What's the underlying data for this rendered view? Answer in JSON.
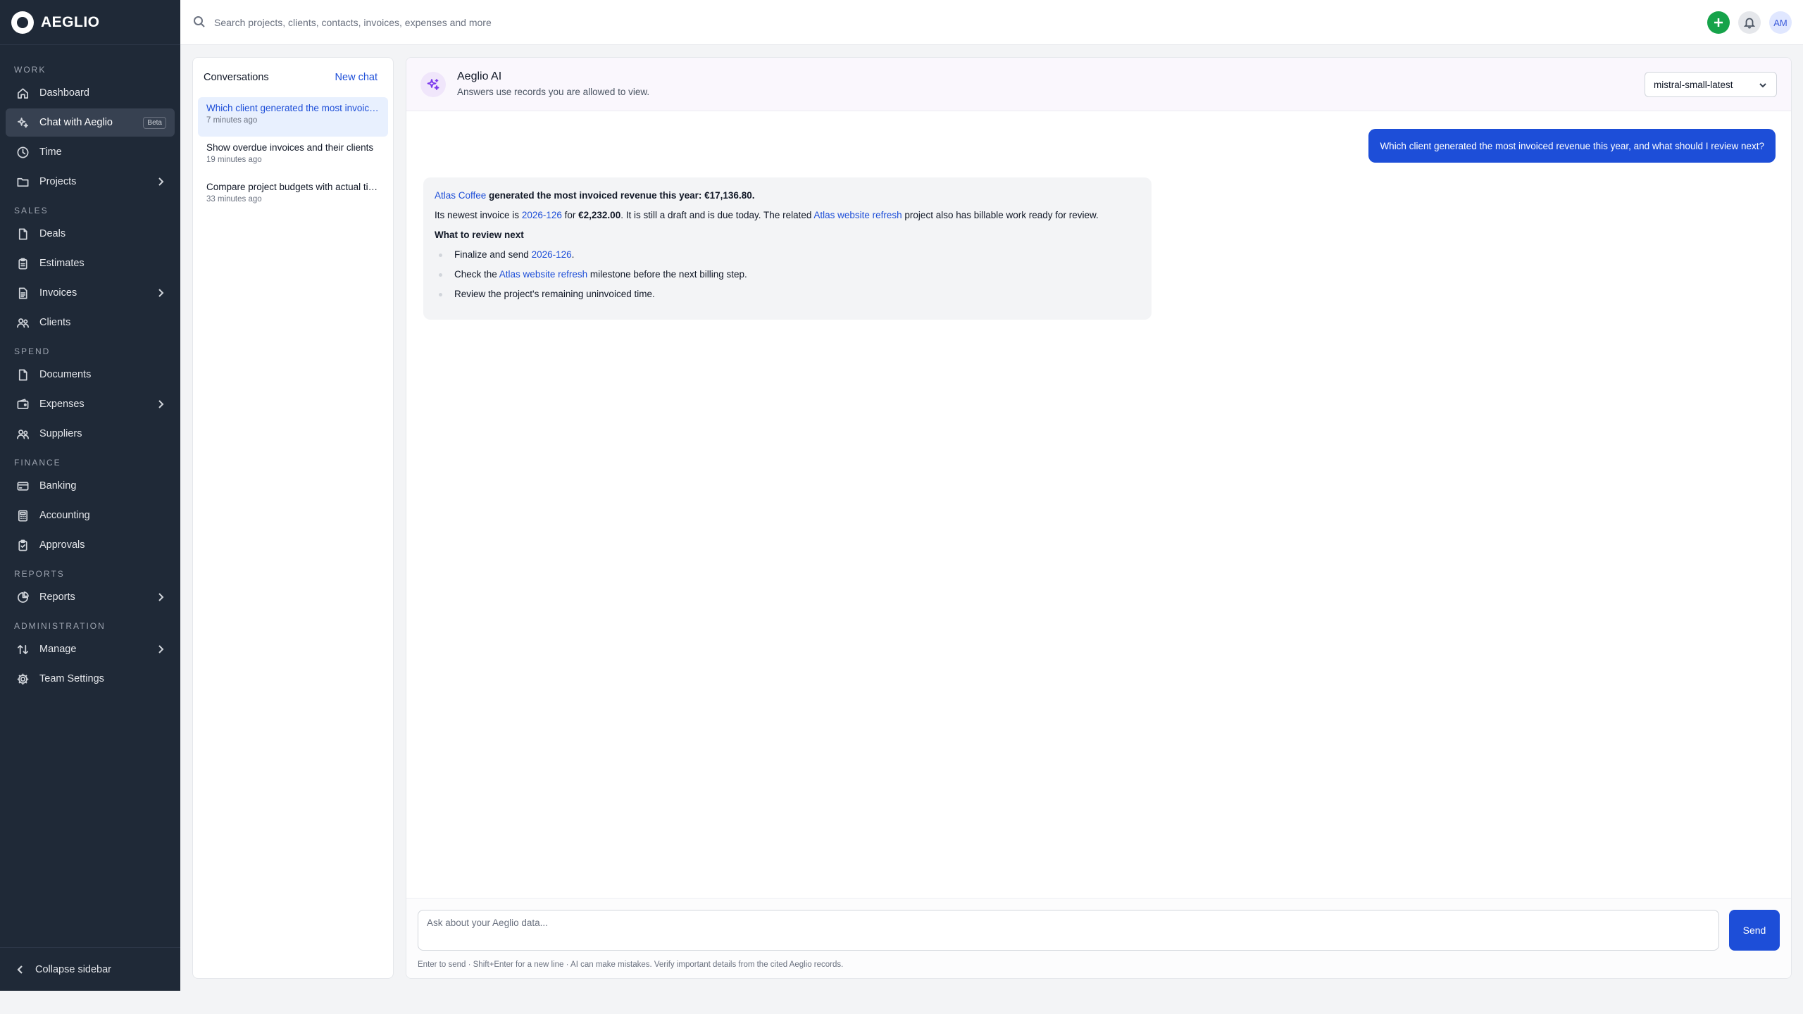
{
  "brand": {
    "name": "AEGLIO"
  },
  "sidebar": {
    "sections": [
      {
        "label": "WORK",
        "items": [
          {
            "label": "Dashboard",
            "icon": "home-icon",
            "key": "dashboard"
          },
          {
            "label": "Chat with Aeglio",
            "icon": "sparkles-icon",
            "key": "chat",
            "active": true,
            "badge": "Beta"
          },
          {
            "label": "Time",
            "icon": "clock-icon",
            "key": "time"
          },
          {
            "label": "Projects",
            "icon": "folder-icon",
            "key": "projects",
            "expandable": true
          }
        ]
      },
      {
        "label": "SALES",
        "items": [
          {
            "label": "Deals",
            "icon": "document-icon",
            "key": "deals"
          },
          {
            "label": "Estimates",
            "icon": "clipboard-icon",
            "key": "estimates"
          },
          {
            "label": "Invoices",
            "icon": "file-text-icon",
            "key": "invoices",
            "expandable": true
          },
          {
            "label": "Clients",
            "icon": "users-icon",
            "key": "clients"
          }
        ]
      },
      {
        "label": "SPEND",
        "items": [
          {
            "label": "Documents",
            "icon": "document-icon",
            "key": "documents"
          },
          {
            "label": "Expenses",
            "icon": "wallet-icon",
            "key": "expenses",
            "expandable": true
          },
          {
            "label": "Suppliers",
            "icon": "users-icon",
            "key": "suppliers"
          }
        ]
      },
      {
        "label": "FINANCE",
        "items": [
          {
            "label": "Banking",
            "icon": "credit-card-icon",
            "key": "banking"
          },
          {
            "label": "Accounting",
            "icon": "calculator-icon",
            "key": "accounting"
          },
          {
            "label": "Approvals",
            "icon": "clipboard-check-icon",
            "key": "approvals"
          }
        ]
      },
      {
        "label": "REPORTS",
        "items": [
          {
            "label": "Reports",
            "icon": "pie-chart-icon",
            "key": "reports",
            "expandable": true
          }
        ]
      },
      {
        "label": "ADMINISTRATION",
        "items": [
          {
            "label": "Manage",
            "icon": "arrows-icon",
            "key": "manage",
            "expandable": true
          },
          {
            "label": "Team Settings",
            "icon": "gear-icon",
            "key": "team-settings"
          }
        ]
      }
    ],
    "collapse_label": "Collapse sidebar"
  },
  "topbar": {
    "search_placeholder": "Search projects, clients, contacts, invoices, expenses and more",
    "avatar_initials": "AM"
  },
  "conversations": {
    "title": "Conversations",
    "new_chat_label": "New chat",
    "items": [
      {
        "title": "Which client generated the most invoiced revenue this year, and what should I review next?",
        "time": "7 minutes ago",
        "selected": true
      },
      {
        "title": "Show overdue invoices and their clients",
        "time": "19 minutes ago"
      },
      {
        "title": "Compare project budgets with actual time",
        "time": "33 minutes ago"
      }
    ]
  },
  "chat": {
    "assistant_name": "Aeglio AI",
    "assistant_subtitle": "Answers use records you are allowed to view.",
    "model": "mistral-small-latest",
    "user_message": "Which client generated the most invoiced revenue this year, and what should I review next?",
    "answer": {
      "client": "Atlas Coffee",
      "line1_rest": " generated the most invoiced revenue this year: €17,136.80.",
      "line2_a": "Its newest invoice is ",
      "invoice": "2026-126",
      "line2_b": " for ",
      "amount": "€2,232.00",
      "line2_c": ". It is still a draft and is due today. The related ",
      "project": "Atlas website refresh",
      "line2_d": " project also has billable work ready for review.",
      "review_heading": "What to review next",
      "bullet1_a": "Finalize and send ",
      "bullet1_end": ".",
      "bullet2_a": "Check the ",
      "bullet2_b": " milestone before the next billing step.",
      "bullet3": "Review the project's remaining uninvoiced time."
    },
    "composer_placeholder": "Ask about your Aeglio data...",
    "send_label": "Send",
    "hint": "Enter to send · Shift+Enter for a new line · AI can make mistakes. Verify important details from the cited Aeglio records."
  }
}
